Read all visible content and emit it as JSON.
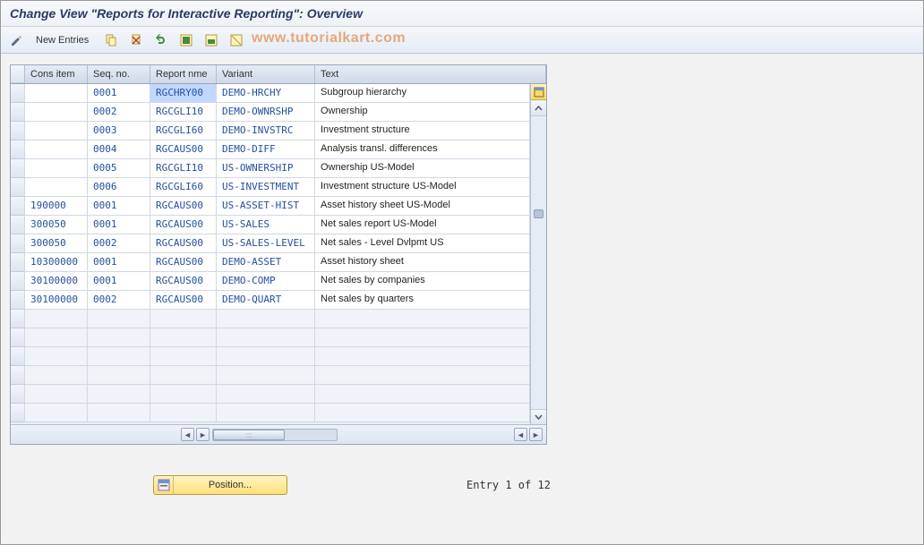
{
  "header": {
    "title": "Change View \"Reports for Interactive Reporting\": Overview"
  },
  "toolbar": {
    "new_entries_label": "New Entries"
  },
  "watermark": "www.tutorialkart.com",
  "columns": {
    "cons_item": "Cons item",
    "seq_no": "Seq. no.",
    "report_name": "Report nme",
    "variant": "Variant",
    "text": "Text"
  },
  "rows": [
    {
      "cons": "",
      "seq": "0001",
      "report": "RGCHRY00",
      "variant": "DEMO-HRCHY",
      "text": "Subgroup hierarchy",
      "highlight": true
    },
    {
      "cons": "",
      "seq": "0002",
      "report": "RGCGLI10",
      "variant": "DEMO-OWNRSHP",
      "text": "Ownership"
    },
    {
      "cons": "",
      "seq": "0003",
      "report": "RGCGLI60",
      "variant": "DEMO-INVSTRC",
      "text": "Investment structure"
    },
    {
      "cons": "",
      "seq": "0004",
      "report": "RGCAUS00",
      "variant": "DEMO-DIFF",
      "text": "Analysis transl. differences"
    },
    {
      "cons": "",
      "seq": "0005",
      "report": "RGCGLI10",
      "variant": "US-OWNERSHIP",
      "text": "Ownership US-Model"
    },
    {
      "cons": "",
      "seq": "0006",
      "report": "RGCGLI60",
      "variant": "US-INVESTMENT",
      "text": "Investment structure US-Model"
    },
    {
      "cons": "190000",
      "seq": "0001",
      "report": "RGCAUS00",
      "variant": "US-ASSET-HIST",
      "text": "Asset history sheet US-Model"
    },
    {
      "cons": "300050",
      "seq": "0001",
      "report": "RGCAUS00",
      "variant": "US-SALES",
      "text": "Net sales report US-Model"
    },
    {
      "cons": "300050",
      "seq": "0002",
      "report": "RGCAUS00",
      "variant": "US-SALES-LEVEL",
      "text": "Net sales - Level Dvlpmt US"
    },
    {
      "cons": "10300000",
      "seq": "0001",
      "report": "RGCAUS00",
      "variant": "DEMO-ASSET",
      "text": "Asset history sheet"
    },
    {
      "cons": "30100000",
      "seq": "0001",
      "report": "RGCAUS00",
      "variant": "DEMO-COMP",
      "text": "Net sales by companies"
    },
    {
      "cons": "30100000",
      "seq": "0002",
      "report": "RGCAUS00",
      "variant": "DEMO-QUART",
      "text": "Net sales by quarters"
    }
  ],
  "empty_rows": 6,
  "footer": {
    "position_label": "Position...",
    "entry_text": "Entry 1 of 12"
  }
}
